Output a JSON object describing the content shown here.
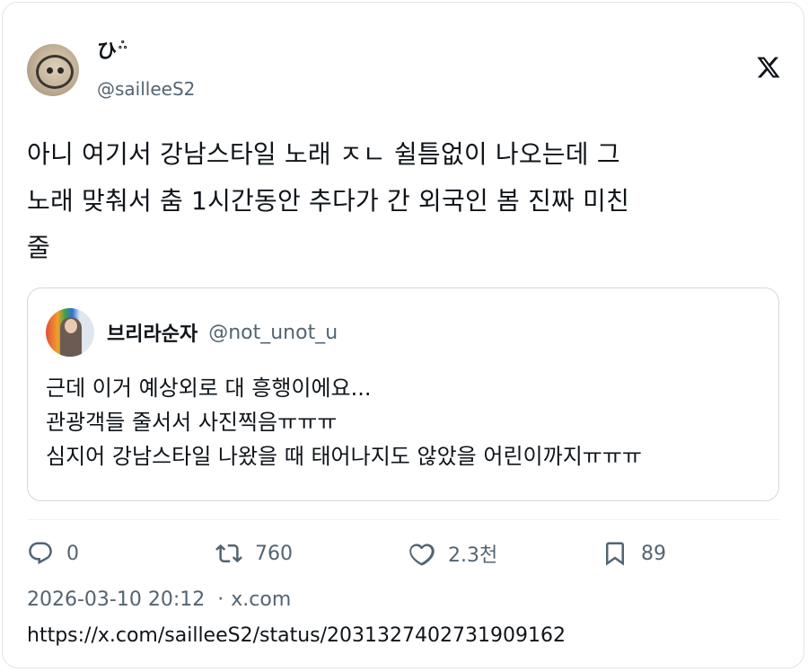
{
  "author": {
    "display_name": "ひ",
    "sticker": "ஃ",
    "handle": "@sailleeS2"
  },
  "icons": {
    "brand": "x-logo-icon",
    "reply": "reply-icon",
    "retweet": "retweet-icon",
    "like": "heart-icon",
    "bookmark": "bookmark-icon"
  },
  "tweet": {
    "lines": [
      "아니 여기서 강남스타일 노래 ㅈㄴ 쉴틈없이 나오는데 그",
      "노래 맞춰서 춤 1시간동안 추다가 간 외국인 봄 진짜 미친",
      "줄"
    ]
  },
  "quote": {
    "name": "브리라순자",
    "handle": "@not_unot_u",
    "lines": [
      "근데 이거 예상외로 대 흥행이에요...",
      "관광객들 줄서서 사진찍음ㅠㅠㅠ",
      "심지어 강남스타일 나왔을 때 태어나지도 않았을 어린이까지ㅠㅠㅠ"
    ]
  },
  "stats": {
    "replies": "0",
    "retweets": "760",
    "likes": "2.3천",
    "bookmarks": "89"
  },
  "meta": {
    "timestamp": "2026-03-10 20:12",
    "separator": "·",
    "source": "x.com"
  },
  "url": "https://x.com/sailleeS2/status/2031327402731909162",
  "colors": {
    "text": "#0f1419",
    "secondary": "#536471",
    "border": "#cfd9de"
  }
}
